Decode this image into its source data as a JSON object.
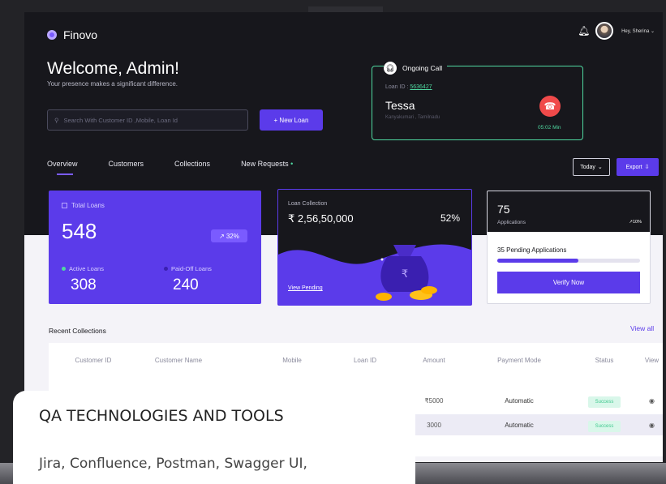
{
  "brand": {
    "name": "Finovo"
  },
  "user": {
    "greeting": "Hey, Sherina ⌄"
  },
  "hero": {
    "title": "Welcome, Admin!",
    "subtitle": "Your presence makes a significant difference.",
    "search_placeholder": "Search With Customer ID ,Mobile, Loan Id",
    "new_loan": "+ New Loan"
  },
  "call": {
    "label": "Ongoing Call",
    "loan_id_label": "Loan ID : ",
    "loan_id": "5636427",
    "name": "Tessa",
    "location": "Kanyakumari , Tamilnadu",
    "timer": "05:02 Min"
  },
  "tabs": [
    "Overview",
    "Customers",
    "Collections",
    "New Requests"
  ],
  "filters": {
    "period": "Today",
    "export": "Export"
  },
  "total_loans": {
    "label": "Total Loans",
    "value": "548",
    "change": "32%",
    "active_label": "Active Loans",
    "active_value": "308",
    "paid_label": "Paid-Off Loans",
    "paid_value": "240"
  },
  "collection": {
    "label": "Loan Collection",
    "value": "₹ 2,56,50,000",
    "percent": "52%",
    "link": "View Pending"
  },
  "applications": {
    "value": "75",
    "label": "Applications",
    "badge": "↗10%",
    "pending": "35 Pending Applications",
    "pending_progress": 0.57,
    "button": "Verify Now"
  },
  "recent": {
    "title": "Recent Collections",
    "view_all": "View all",
    "columns": [
      "Customer ID",
      "Customer Name",
      "Mobile",
      "Loan ID",
      "Amount",
      "Payment Mode",
      "Status",
      "View"
    ],
    "rows": [
      {
        "amount": "₹5000",
        "mode": "Automatic",
        "status": "Success"
      },
      {
        "amount": "3000",
        "mode": "Automatic",
        "status": "Success"
      }
    ]
  },
  "overlay": {
    "title": "QA TECHNOLOGIES AND TOOLS",
    "body": "Jira, Confluence, Postman, Swagger UI,"
  },
  "colors": {
    "accent": "#5b3bea",
    "dark": "#17171c",
    "success": "#3fc88e",
    "danger": "#f04a4a"
  }
}
